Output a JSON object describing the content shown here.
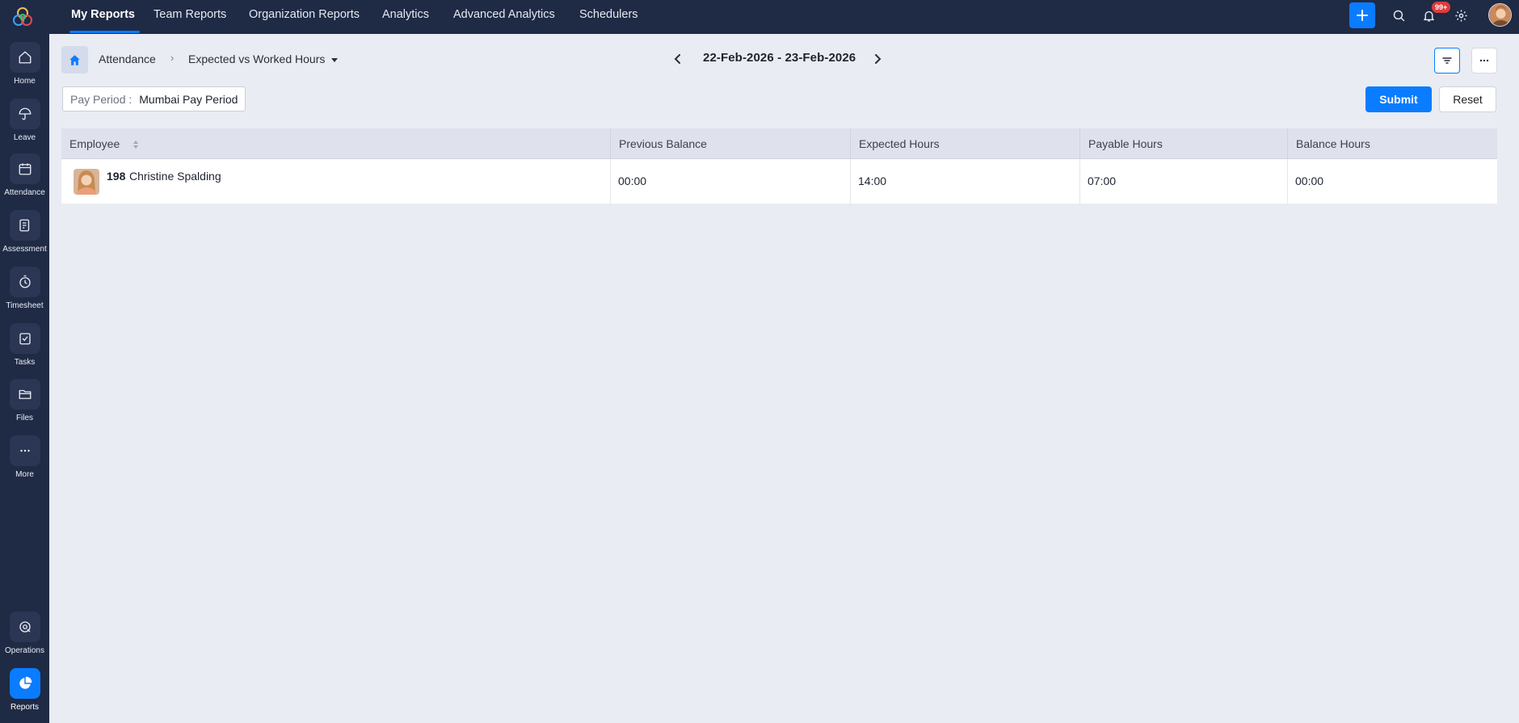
{
  "top_tabs": [
    {
      "label": "My Reports",
      "active": true
    },
    {
      "label": "Team Reports",
      "active": false
    },
    {
      "label": "Organization Reports",
      "active": false
    },
    {
      "label": "Analytics",
      "active": false
    },
    {
      "label": "Advanced Analytics",
      "active": false
    },
    {
      "label": "Schedulers",
      "active": false
    }
  ],
  "header_icons": {
    "add": "plus-icon",
    "search": "search-icon",
    "notifications": "bell-icon",
    "settings": "gear-icon",
    "notification_badge": "99+"
  },
  "sidebar": {
    "items": [
      {
        "label": "Home",
        "icon": "home-icon"
      },
      {
        "label": "Leave",
        "icon": "umbrella-icon"
      },
      {
        "label": "Attendance",
        "icon": "calendar-icon"
      },
      {
        "label": "Assessment",
        "icon": "assessment-icon"
      },
      {
        "label": "Timesheet",
        "icon": "timer-icon"
      },
      {
        "label": "Tasks",
        "icon": "tasks-icon"
      },
      {
        "label": "Files",
        "icon": "folder-icon"
      },
      {
        "label": "More",
        "icon": "more-icon"
      }
    ],
    "bottom_items": [
      {
        "label": "Operations",
        "icon": "operations-icon"
      },
      {
        "label": "Reports",
        "icon": "pie-chart-icon",
        "active": true
      }
    ]
  },
  "breadcrumb": {
    "module": "Attendance",
    "report": "Expected vs Worked Hours"
  },
  "date_range": "22-Feb-2026 - 23-Feb-2026",
  "filters": {
    "pay_period_label": "Pay Period :",
    "pay_period_value": "Mumbai Pay Period",
    "submit_label": "Submit",
    "reset_label": "Reset"
  },
  "colors": {
    "sidebar_bg": "#1f2a45",
    "accent": "#0a7cff",
    "page_bg": "#e9ecf2",
    "badge": "#e03b3b"
  },
  "table": {
    "columns": [
      "Employee",
      "Previous Balance",
      "Expected Hours",
      "Payable Hours",
      "Balance Hours"
    ],
    "rows": [
      {
        "employee_id": "198",
        "employee_name": "Christine Spalding",
        "previous_balance": "00:00",
        "expected_hours": "14:00",
        "payable_hours": "07:00",
        "balance_hours": "00:00"
      }
    ]
  }
}
